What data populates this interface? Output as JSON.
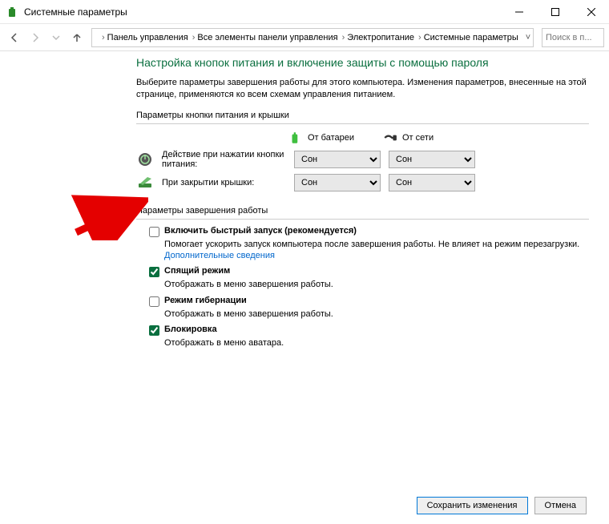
{
  "window": {
    "title": "Системные параметры"
  },
  "breadcrumb": {
    "items": [
      "Панель управления",
      "Все элементы панели управления",
      "Электропитание",
      "Системные параметры"
    ]
  },
  "search": {
    "placeholder": "Поиск в п..."
  },
  "page": {
    "heading": "Настройка кнопок питания и включение защиты с помощью пароля",
    "intro": "Выберите параметры завершения работы для этого компьютера. Изменения параметров, внесенные на этой странице, применяются ко всем схемам управления питанием.",
    "section1": "Параметры кнопки питания и крышки",
    "cols": {
      "battery": "От батареи",
      "ac": "От сети"
    },
    "row1": {
      "label": "Действие при нажатии кнопки питания:",
      "battery": "Сон",
      "ac": "Сон"
    },
    "row2": {
      "label": "При закрытии крышки:",
      "battery": "Сон",
      "ac": "Сон"
    },
    "section2": "Параметры завершения работы",
    "opt_fast": {
      "label": "Включить быстрый запуск (рекомендуется)",
      "desc": "Помогает ускорить запуск компьютера после завершения работы. Не влияет на режим перезагрузки.",
      "link": "Дополнительные сведения"
    },
    "opt_sleep": {
      "label": "Спящий режим",
      "desc": "Отображать в меню завершения работы."
    },
    "opt_hib": {
      "label": "Режим гибернации",
      "desc": "Отображать в меню завершения работы."
    },
    "opt_lock": {
      "label": "Блокировка",
      "desc": "Отображать в меню аватара."
    }
  },
  "footer": {
    "save": "Сохранить изменения",
    "cancel": "Отмена"
  }
}
